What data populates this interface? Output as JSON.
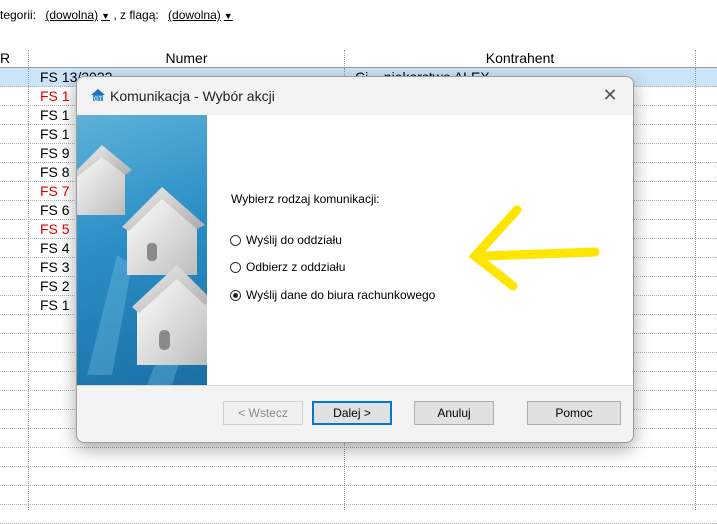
{
  "filter": {
    "prefix": "tegorii:",
    "category_value": "(dowolna)",
    "flag_label": ", z flagą:",
    "flag_value": "(dowolna)"
  },
  "grid": {
    "columns": {
      "r": "R",
      "numer": "Numer",
      "kontrahent": "Kontrahent"
    },
    "rows": [
      {
        "numer": "FS 13/2022",
        "kontrahent": "Ci... piekarstwo ALEX",
        "red": false,
        "selected": true
      },
      {
        "numer": "FS 1",
        "red": true
      },
      {
        "numer": "FS 1",
        "red": false
      },
      {
        "numer": "FS 1",
        "red": false
      },
      {
        "numer": "FS 9",
        "red": false
      },
      {
        "numer": "FS 8",
        "red": false
      },
      {
        "numer": "FS 7",
        "red": true
      },
      {
        "numer": "FS 6",
        "red": false
      },
      {
        "numer": "FS 5",
        "red": true
      },
      {
        "numer": "FS 4",
        "red": false
      },
      {
        "numer": "FS 3",
        "red": false
      },
      {
        "numer": "FS 2",
        "red": false
      },
      {
        "numer": "FS 1",
        "red": false
      }
    ]
  },
  "dialog": {
    "title": "Komunikacja - Wybór akcji",
    "icon": "house-app-icon",
    "prompt": "Wybierz rodzaj komunikacji:",
    "options": [
      {
        "label": "Wyślij do oddziału",
        "checked": false
      },
      {
        "label": "Odbierz z oddziału",
        "checked": false
      },
      {
        "label": "Wyślij dane do biura rachunkowego",
        "checked": true
      }
    ],
    "buttons": {
      "back": "< Wstecz",
      "next": "Dalej >",
      "cancel": "Anuluj",
      "help": "Pomoc"
    }
  },
  "annotation": {
    "arrow_color": "#ffe600"
  }
}
